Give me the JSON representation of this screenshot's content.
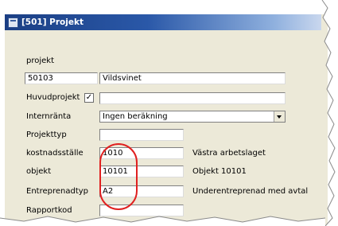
{
  "window": {
    "title": "[501] Projekt"
  },
  "form": {
    "projekt_label": "projekt",
    "projekt_number": "50103",
    "projekt_name": "Vildsvinet",
    "huvudprojekt_label": "Huvudprojekt",
    "huvudprojekt_checked": "✓",
    "internranta_label": "Internränta",
    "internranta_value": "Ingen beräkning",
    "projekttyp_label": "Projekttyp",
    "kostnadsstalle_label": "kostnadsställe",
    "kostnadsstalle_value": "1010",
    "kostnadsstalle_desc": "Västra arbetslaget",
    "objekt_label": "objekt",
    "objekt_value": "10101",
    "objekt_desc": "Objekt 10101",
    "entreprenadtyp_label": "Entreprenadtyp",
    "entreprenadtyp_value": "A2",
    "entreprenadtyp_desc": "Underentreprenad med avtal",
    "rapportkod_label": "Rapportkod"
  },
  "annotation": {
    "color": "#e02020"
  }
}
